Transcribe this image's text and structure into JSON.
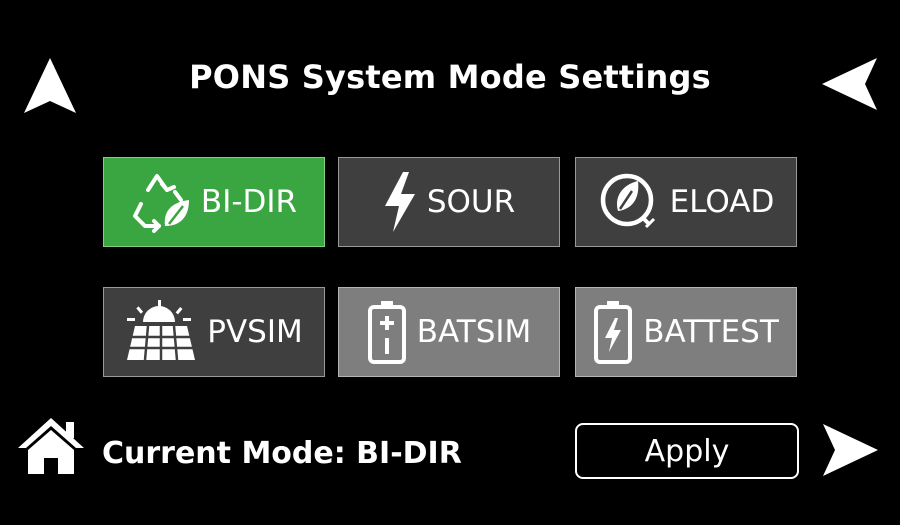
{
  "header": {
    "title": "PONS System Mode Settings"
  },
  "modes": [
    {
      "label": "BI-DIR",
      "icon": "recycle-leaf-icon"
    },
    {
      "label": "SOUR",
      "icon": "lightning-icon"
    },
    {
      "label": "ELOAD",
      "icon": "leaf-plug-icon"
    },
    {
      "label": "PVSIM",
      "icon": "solar-panel-icon"
    },
    {
      "label": "BATSIM",
      "icon": "battery-icon"
    },
    {
      "label": "BATTEST",
      "icon": "battery-charge-icon"
    }
  ],
  "footer": {
    "current_mode": "Current Mode: BI-DIR",
    "apply_label": "Apply"
  },
  "colors": {
    "active": "#3aa642",
    "inactive_dark": "#3f3f3f",
    "inactive_light": "#7e7e7e"
  }
}
